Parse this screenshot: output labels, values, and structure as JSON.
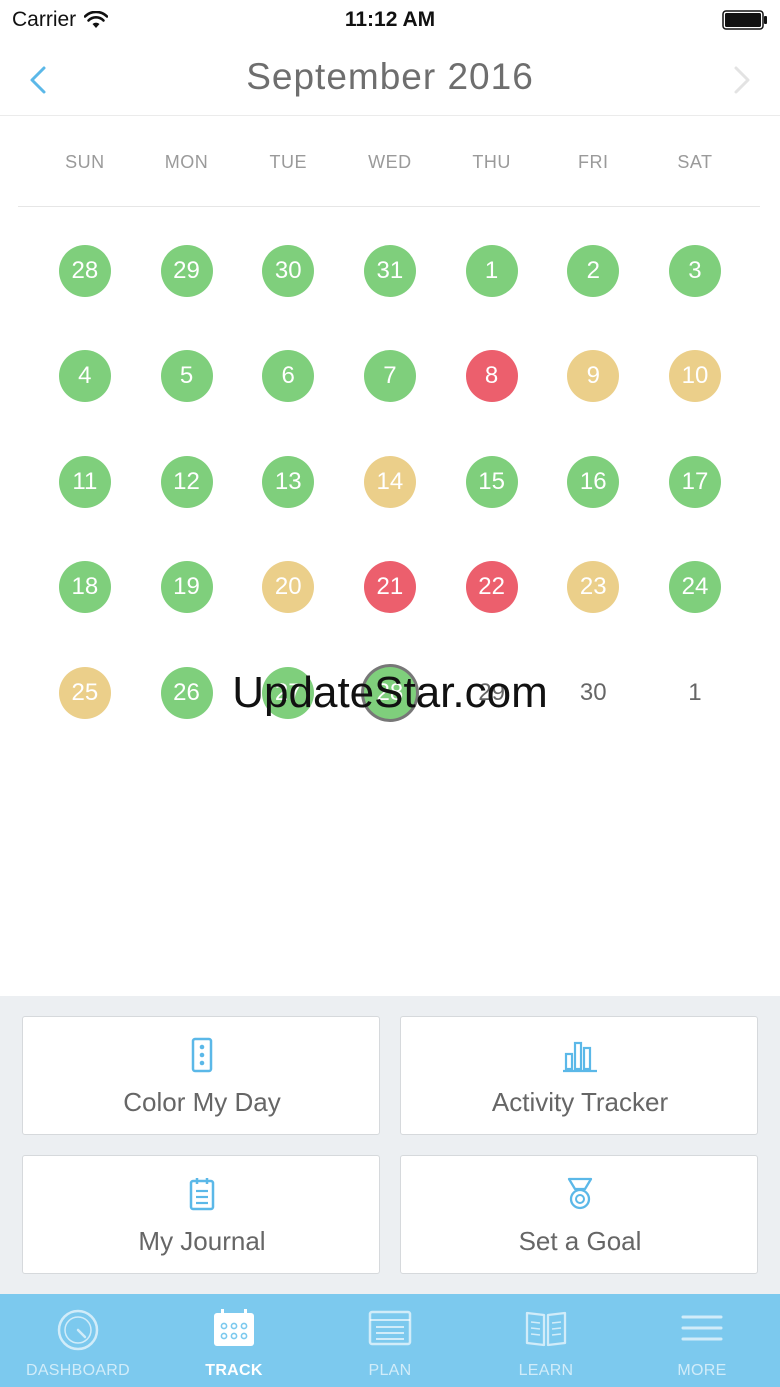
{
  "status_bar": {
    "carrier": "Carrier",
    "time": "11:12 AM"
  },
  "header": {
    "title": "September 2016"
  },
  "weekdays": [
    "SUN",
    "MON",
    "TUE",
    "WED",
    "THU",
    "FRI",
    "SAT"
  ],
  "calendar": {
    "weeks": [
      [
        {
          "d": "28",
          "c": "green"
        },
        {
          "d": "29",
          "c": "green"
        },
        {
          "d": "30",
          "c": "green"
        },
        {
          "d": "31",
          "c": "green"
        },
        {
          "d": "1",
          "c": "green"
        },
        {
          "d": "2",
          "c": "green"
        },
        {
          "d": "3",
          "c": "green"
        }
      ],
      [
        {
          "d": "4",
          "c": "green"
        },
        {
          "d": "5",
          "c": "green"
        },
        {
          "d": "6",
          "c": "green"
        },
        {
          "d": "7",
          "c": "green"
        },
        {
          "d": "8",
          "c": "red"
        },
        {
          "d": "9",
          "c": "yellow"
        },
        {
          "d": "10",
          "c": "yellow"
        }
      ],
      [
        {
          "d": "11",
          "c": "green"
        },
        {
          "d": "12",
          "c": "green"
        },
        {
          "d": "13",
          "c": "green"
        },
        {
          "d": "14",
          "c": "yellow"
        },
        {
          "d": "15",
          "c": "green"
        },
        {
          "d": "16",
          "c": "green"
        },
        {
          "d": "17",
          "c": "green"
        }
      ],
      [
        {
          "d": "18",
          "c": "green"
        },
        {
          "d": "19",
          "c": "green"
        },
        {
          "d": "20",
          "c": "yellow"
        },
        {
          "d": "21",
          "c": "red"
        },
        {
          "d": "22",
          "c": "red"
        },
        {
          "d": "23",
          "c": "yellow"
        },
        {
          "d": "24",
          "c": "green"
        }
      ],
      [
        {
          "d": "25",
          "c": "yellow"
        },
        {
          "d": "26",
          "c": "green"
        },
        {
          "d": "27",
          "c": "green"
        },
        {
          "d": "28",
          "c": "green",
          "today": true
        },
        {
          "d": "29",
          "c": "plain"
        },
        {
          "d": "30",
          "c": "plain"
        },
        {
          "d": "1",
          "c": "plain"
        }
      ]
    ]
  },
  "watermark": "UpdateStar.com",
  "actions": {
    "color_my_day": "Color My Day",
    "activity_tracker": "Activity Tracker",
    "my_journal": "My Journal",
    "set_a_goal": "Set a Goal"
  },
  "tabbar": {
    "dashboard": "DASHBOARD",
    "track": "TRACK",
    "plan": "PLAN",
    "learn": "LEARN",
    "more": "MORE"
  },
  "colors": {
    "green": "#7fcf7c",
    "yellow": "#ebcf8a",
    "red": "#ec5f6d",
    "accent": "#5bb8e8",
    "tabbar": "#7cc9ee"
  }
}
